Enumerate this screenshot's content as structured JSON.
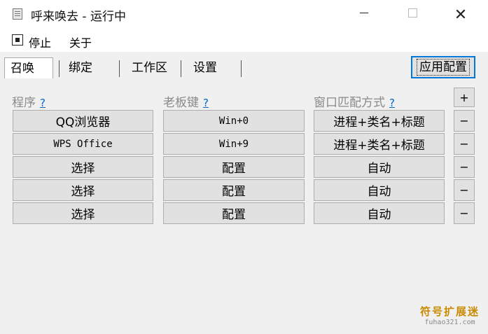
{
  "window": {
    "title": "呼来唤去 - 运行中",
    "minimize_icon": "minimize-icon",
    "maximize_icon": "maximize-icon",
    "close_glyph": "✕"
  },
  "menu": {
    "stop_label": "停止",
    "about_label": "关于",
    "stop_icon": "stop-square-icon"
  },
  "tabs": [
    {
      "label": "召唤",
      "active": true
    },
    {
      "label": "绑定",
      "active": false
    },
    {
      "label": "工作区",
      "active": false
    },
    {
      "label": "设置",
      "active": false
    }
  ],
  "apply_label": "应用配置",
  "columns": {
    "program": "程序",
    "hotkey": "老板键",
    "match": "窗口匹配方式",
    "help": "?"
  },
  "add_label": "+",
  "remove_label": "−",
  "rows": [
    {
      "program": "QQ浏览器",
      "hotkey": "Win+0",
      "match": "进程+类名+标题"
    },
    {
      "program": "WPS Office",
      "hotkey": "Win+9",
      "match": "进程+类名+标题"
    },
    {
      "program": "选择",
      "hotkey": "配置",
      "match": "自动"
    },
    {
      "program": "选择",
      "hotkey": "配置",
      "match": "自动"
    },
    {
      "program": "选择",
      "hotkey": "配置",
      "match": "自动"
    }
  ],
  "watermark": {
    "main": "符号扩展迷",
    "sub": "fuhao321.com"
  },
  "colors": {
    "accent": "#0078d7",
    "link": "#0066cc",
    "watermark": "#c98a00"
  }
}
